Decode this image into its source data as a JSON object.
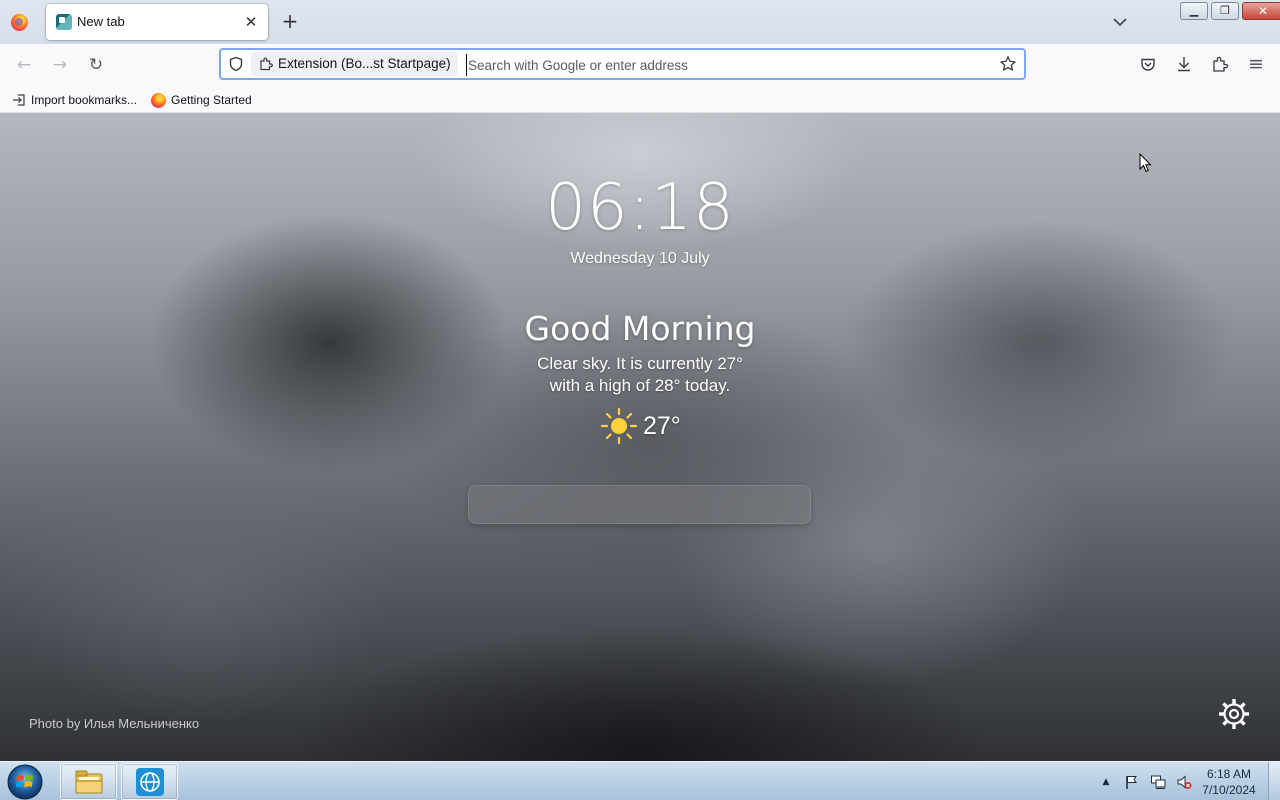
{
  "browser": {
    "tab": {
      "title": "New tab",
      "close_glyph": "✕"
    },
    "newtab_glyph": "+",
    "window_controls": {
      "minimize_glyph": "▁",
      "restore_glyph": "❐",
      "close_glyph": "✕"
    },
    "nav": {
      "back_glyph": "←",
      "forward_glyph": "→",
      "reload_glyph": "↻"
    },
    "urlbar": {
      "identity_text": "Extension (Bo...st Startpage)",
      "placeholder": "Search with Google or enter address",
      "value": ""
    },
    "toolbar_right": {
      "pocket_icon": "pocket-icon",
      "downloads_icon": "download-icon",
      "extensions_icon": "puzzle-icon",
      "menu_glyph": "≡"
    },
    "bookmarks": [
      {
        "label": "Import bookmarks...",
        "icon": "import-icon"
      },
      {
        "label": "Getting Started",
        "icon": "firefox-icon"
      }
    ]
  },
  "startpage": {
    "time": "06:18",
    "date": "Wednesday 10 July",
    "greeting": "Good Morning",
    "weather_line1": "Clear sky. It is currently 27°",
    "weather_line2": "with a high of 28° today.",
    "current_temp": "27°",
    "weather_icon": "sun-icon",
    "search_value": "",
    "photo_credit": "Photo by Илья Мельниченко"
  },
  "taskbar": {
    "clock_time": "6:18 AM",
    "clock_date": "7/10/2024",
    "tray_glyphs": {
      "overflow": "▲"
    },
    "items": [
      {
        "name": "file-explorer",
        "icon": "folder-icon"
      },
      {
        "name": "browser",
        "icon": "globe-icon"
      }
    ]
  },
  "colors": {
    "urlbar_focus": "#80a7e9",
    "taskbar": "#bcd2e6",
    "sun": "#ffd23a"
  }
}
